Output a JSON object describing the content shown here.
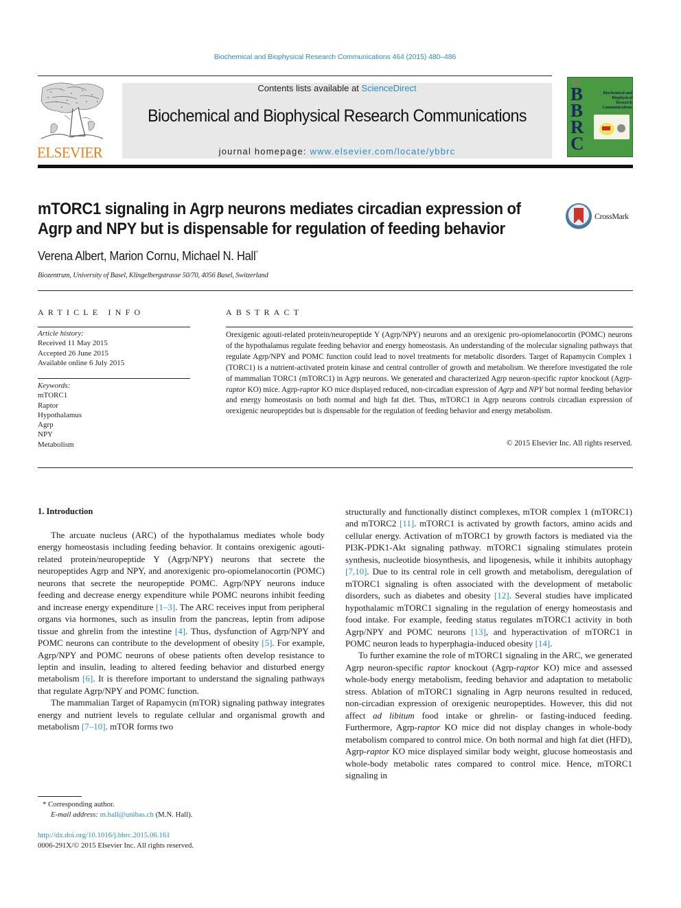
{
  "header": {
    "journal_ref": "Biochemical and Biophysical Research Communications 464 (2015) 480–486",
    "contents_prefix": "Contents lists available at ",
    "contents_link": "ScienceDirect",
    "journal_title": "Biochemical and Biophysical Research Communications",
    "homepage_prefix": "journal homepage: ",
    "homepage_link": "www.elsevier.com/locate/ybbrc",
    "publisher_logo_text": "ELSEVIER",
    "cover": {
      "letters": [
        "B",
        "B",
        "R",
        "C"
      ],
      "title_lines": [
        "Biochemical and",
        "Biophysical",
        "Research",
        "Communications"
      ]
    }
  },
  "article": {
    "title_lines": [
      "mTORC1 signaling in Agrp neurons mediates circadian expression of",
      "Agrp and NPY but is dispensable for regulation of feeding behavior"
    ],
    "crossmark_label": "CrossMark",
    "authors": "Verena Albert, Marion Cornu, Michael N. Hall",
    "author_mark": "*",
    "affiliation": "Biozentrum, University of Basel, Klingelbergstrasse 50/70, 4056 Basel, Switzerland"
  },
  "article_info": {
    "heading": "ARTICLE INFO",
    "history_label": "Article history:",
    "history": [
      "Received 11 May 2015",
      "Accepted 26 June 2015",
      "Available online 6 July 2015"
    ],
    "keywords_label": "Keywords:",
    "keywords": [
      "mTORC1",
      "Raptor",
      "Hypothalamus",
      "Agrp",
      "NPY",
      "Metabolism"
    ]
  },
  "abstract": {
    "heading": "ABSTRACT",
    "segments": [
      {
        "t": "Orexigenic agouti-related protein/neuropeptide Y (Agrp/NPY) neurons and an orexigenic pro-opiomelanocortin (POMC) neurons of the hypothalamus regulate feeding behavior and energy homeostasis. An understanding of the molecular signaling pathways that regulate Agrp/NPY and POMC function could lead to novel treatments for metabolic disorders. Target of Rapamycin Complex 1 (TORC1) is a nutrient-activated protein kinase and central controller of growth and metabolism. We therefore investigated the role of mammalian TORC1 (mTORC1) in Agrp neurons. We generated and characterized Agrp neuron-specific "
      },
      {
        "t": "raptor",
        "i": true
      },
      {
        "t": " knockout (Agrp-"
      },
      {
        "t": "raptor",
        "i": true
      },
      {
        "t": " KO) mice. Agrp-"
      },
      {
        "t": "raptor",
        "i": true
      },
      {
        "t": " KO mice displayed reduced, non-circadian expression of "
      },
      {
        "t": "Agrp",
        "i": true
      },
      {
        "t": " and "
      },
      {
        "t": "NPY",
        "i": true
      },
      {
        "t": " but normal feeding behavior and energy homeostasis on both normal and high fat diet. Thus, mTORC1 in Agrp neurons controls circadian expression of orexigenic neuropeptides but is dispensable for the regulation of feeding behavior and energy metabolism."
      }
    ],
    "copyright": "© 2015 Elsevier Inc. All rights reserved."
  },
  "body": {
    "section_heading": "1.  Introduction",
    "left_paragraphs": [
      [
        {
          "t": "The arcuate nucleus (ARC) of the hypothalamus mediates whole body energy homeostasis including feeding behavior. It contains orexigenic agouti-related protein/neuropeptide Y (Agrp/NPY) neurons that secrete the neuropeptides Agrp and NPY, and anorexigenic pro-opiomelanocortin (POMC) neurons that secrete the neuropeptide POMC. Agrp/NPY neurons induce feeding and decrease energy expenditure while POMC neurons inhibit feeding and increase energy expenditure "
        },
        {
          "t": "[1–3]",
          "ref": true
        },
        {
          "t": ". The ARC receives input from peripheral organs via hormones, such as insulin from the pancreas, leptin from adipose tissue and ghrelin from the intestine "
        },
        {
          "t": "[4]",
          "ref": true
        },
        {
          "t": ". Thus, dysfunction of Agrp/NPY and POMC neurons can contribute to the development of obesity "
        },
        {
          "t": "[5]",
          "ref": true
        },
        {
          "t": ". For example, Agrp/NPY and POMC neurons of obese patients often develop resistance to leptin and insulin, leading to altered feeding behavior and disturbed energy metabolism "
        },
        {
          "t": "[6]",
          "ref": true
        },
        {
          "t": ". It is therefore important to understand the signaling pathways that regulate Agrp/NPY and POMC function."
        }
      ],
      [
        {
          "t": "The mammalian Target of Rapamycin (mTOR) signaling pathway integrates energy and nutrient levels to regulate cellular and organismal growth and metabolism "
        },
        {
          "t": "[7–10]",
          "ref": true
        },
        {
          "t": ". mTOR forms two"
        }
      ]
    ],
    "right_paragraphs": [
      [
        {
          "t": "structurally and functionally distinct complexes, mTOR complex 1 (mTORC1) and mTORC2 "
        },
        {
          "t": "[11]",
          "ref": true
        },
        {
          "t": ". mTORC1 is activated by growth factors, amino acids and cellular energy. Activation of mTORC1 by growth factors is mediated via the PI3K-PDK1-Akt signaling pathway. mTORC1 signaling stimulates protein synthesis, nucleotide biosynthesis, and lipogenesis, while it inhibits autophagy "
        },
        {
          "t": "[7,10]",
          "ref": true
        },
        {
          "t": ". Due to its central role in cell growth and metabolism, deregulation of mTORC1 signaling is often associated with the development of metabolic disorders, such as diabetes and obesity "
        },
        {
          "t": "[12]",
          "ref": true
        },
        {
          "t": ". Several studies have implicated hypothalamic mTORC1 signaling in the regulation of energy homeostasis and food intake. For example, feeding status regulates mTORC1 activity in both Agrp/NPY and POMC neurons "
        },
        {
          "t": "[13]",
          "ref": true
        },
        {
          "t": ", and hyperactivation of mTORC1 in POMC neuron leads to hyperphagia-induced obesity "
        },
        {
          "t": "[14]",
          "ref": true
        },
        {
          "t": "."
        }
      ],
      [
        {
          "t": "To further examine the role of mTORC1 signaling in the ARC, we generated Agrp neuron-specific "
        },
        {
          "t": "raptor",
          "i": true
        },
        {
          "t": " knockout (Agrp-"
        },
        {
          "t": "raptor",
          "i": true
        },
        {
          "t": " KO) mice and assessed whole-body energy metabolism, feeding behavior and adaptation to metabolic stress. Ablation of mTORC1 signaling in Agrp neurons resulted in reduced, non-circadian expression of orexigenic neuropeptides. However, this did not affect "
        },
        {
          "t": "ad libitum",
          "i": true
        },
        {
          "t": " food intake or ghrelin- or fasting-induced feeding. Furthermore, Agrp-"
        },
        {
          "t": "raptor",
          "i": true
        },
        {
          "t": " KO mice did not display changes in whole-body metabolism compared to control mice. On both normal and high fat diet (HFD), Agrp-"
        },
        {
          "t": "raptor",
          "i": true
        },
        {
          "t": " KO mice displayed similar body weight, glucose homeostasis and whole-body metabolic rates compared to control mice. Hence, mTORC1 signaling in"
        }
      ]
    ]
  },
  "footnotes": {
    "corresponding_mark": "*",
    "corresponding_text": "Corresponding author.",
    "email_label": "E-mail address:",
    "email": "m.hall@unibas.ch",
    "email_suffix": " (M.N. Hall).",
    "doi": "http://dx.doi.org/10.1016/j.bbrc.2015.06.161",
    "issn_copyright": "0006-291X/© 2015 Elsevier Inc. All rights reserved."
  },
  "colors": {
    "link": "#2a8cc4",
    "elsevier_orange": "#f07d16",
    "cover_green": "#4a9a44",
    "masthead_grey": "#e8e8e8"
  }
}
